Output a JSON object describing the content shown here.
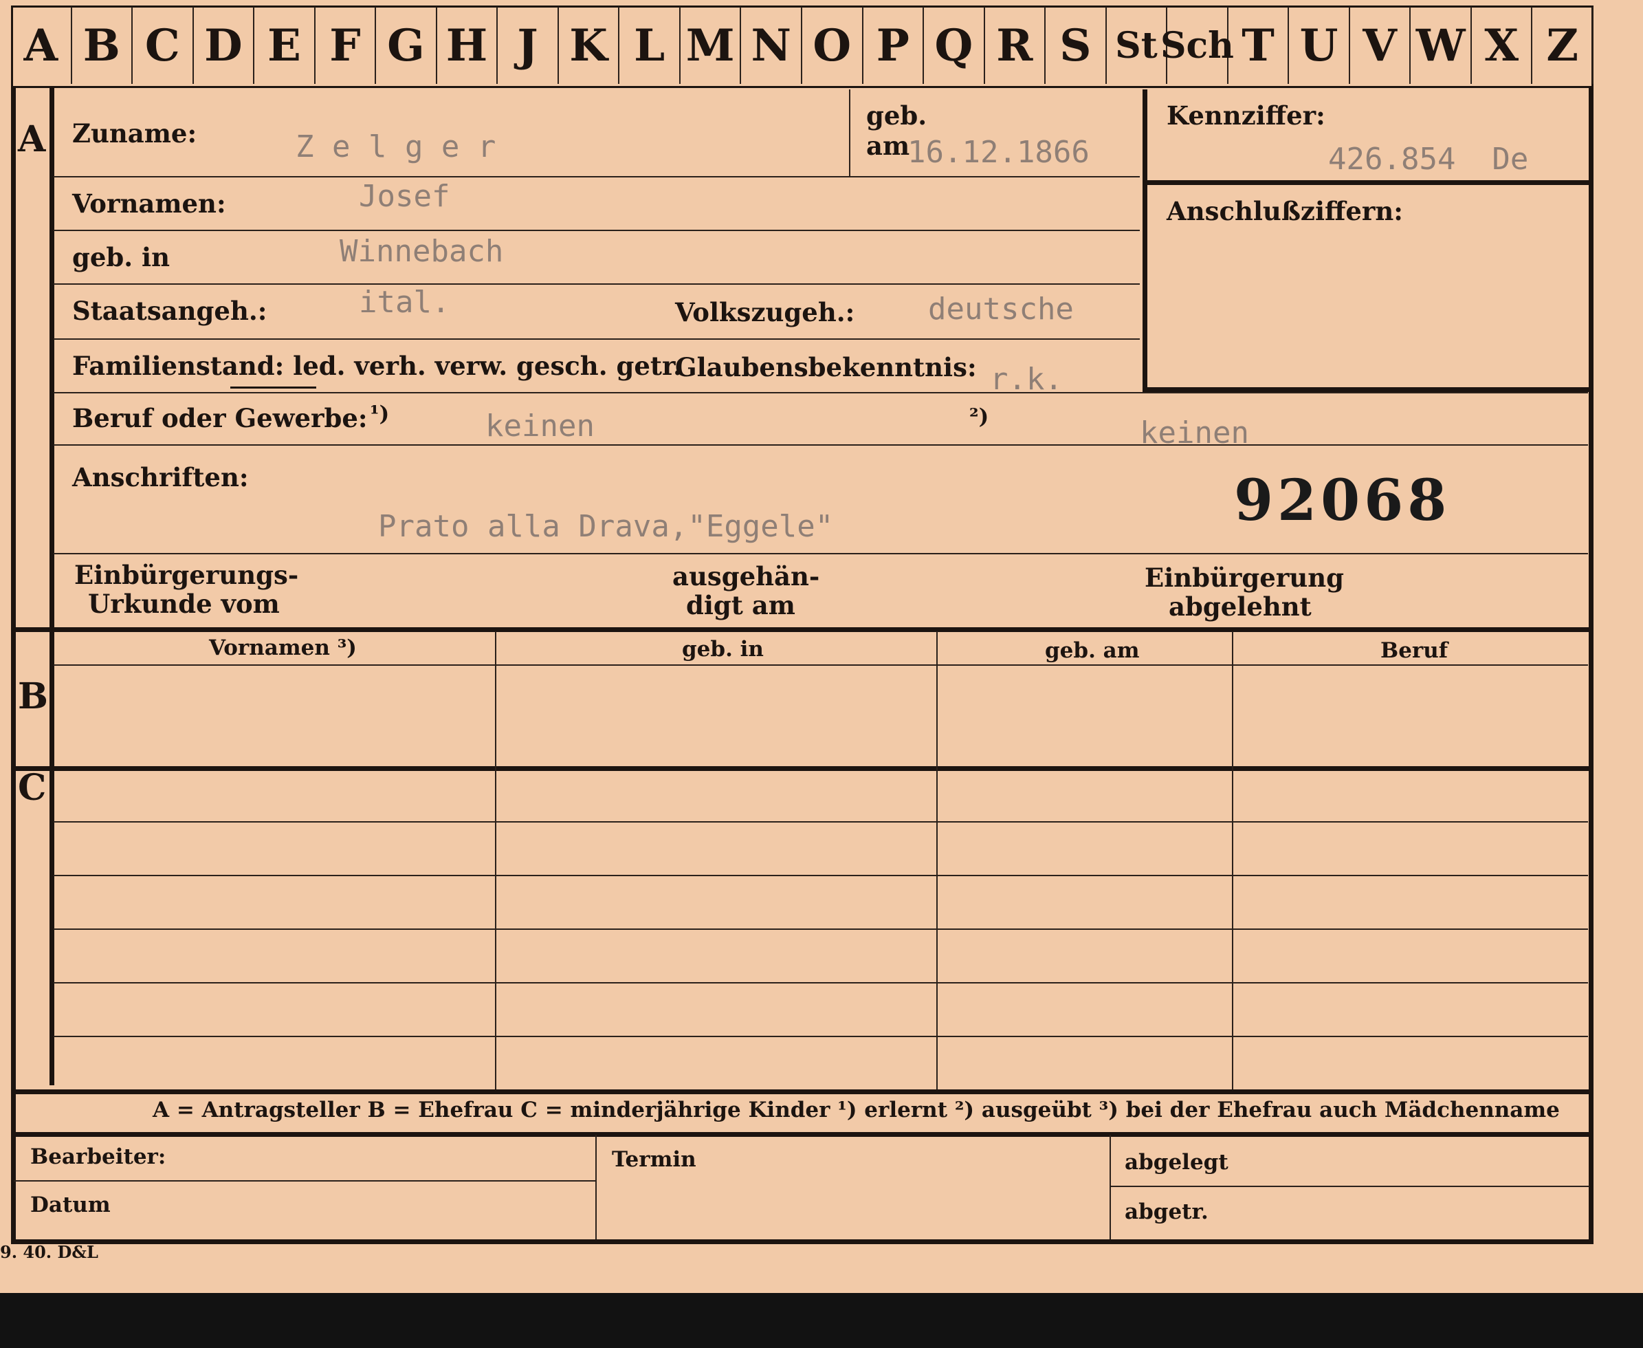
{
  "tabs": [
    "A",
    "B",
    "C",
    "D",
    "E",
    "F",
    "G",
    "H",
    "J",
    "K",
    "L",
    "M",
    "N",
    "O",
    "P",
    "Q",
    "R",
    "S",
    "St",
    "Sch",
    "T",
    "U",
    "V",
    "W",
    "X",
    "Z"
  ],
  "sections": {
    "a": "A",
    "b": "B",
    "c": "C"
  },
  "labels": {
    "zuname": "Zuname:",
    "geb": "geb.",
    "am": "am",
    "kennziffer": "Kennziffer:",
    "anschlussziffern": "Anschlußziffern:",
    "vornamen": "Vornamen:",
    "geb_in": "geb. in",
    "staatsangeh": "Staatsangeh.:",
    "volkszugeh": "Volkszugeh.:",
    "familienstand": "Familienstand: led. verh. verw. gesch. getr.",
    "glaubensbekenntnis": "Glaubensbekenntnis:",
    "beruf": "Beruf oder Gewerbe:",
    "beruf_fn1": "¹)",
    "beruf_fn2": "²)",
    "anschriften": "Anschriften:",
    "einbuergerungs_1": "Einbürgerungs-",
    "einbuergerungs_2": "Urkunde vom",
    "ausgehaendigt_1": "ausgehän-",
    "ausgehaendigt_2": "digt am",
    "abgelehnt_1": "Einbürgerung",
    "abgelehnt_2": "abgelehnt"
  },
  "values": {
    "zuname": "Z e l g e r",
    "geb_am": "16.12.1866",
    "kennziffer": "426.854  De",
    "vornamen": "Josef",
    "geb_in": "Winnebach",
    "staatsangeh": "ital.",
    "volkszugeh": "deutsche",
    "glaube": "r.k.",
    "beruf_erlernt": "keinen",
    "beruf_ausgeuebt": "keinen",
    "anschrift": "Prato alla Drava,\"Eggele\"",
    "record_number": "92068"
  },
  "table_headers": [
    "Vornamen ³)",
    "geb. in",
    "geb. am",
    "Beruf"
  ],
  "legend": "A = Antragsteller   B = Ehefrau   C = minderjährige Kinder   ¹) erlernt   ²) ausgeübt   ³) bei der Ehefrau auch Mädchenname",
  "footer": {
    "bearbeiter": "Bearbeiter:",
    "datum": "Datum",
    "termin": "Termin",
    "abgelegt": "abgelegt",
    "abgetr": "abgetr."
  },
  "print_note": "9. 40. D&L"
}
